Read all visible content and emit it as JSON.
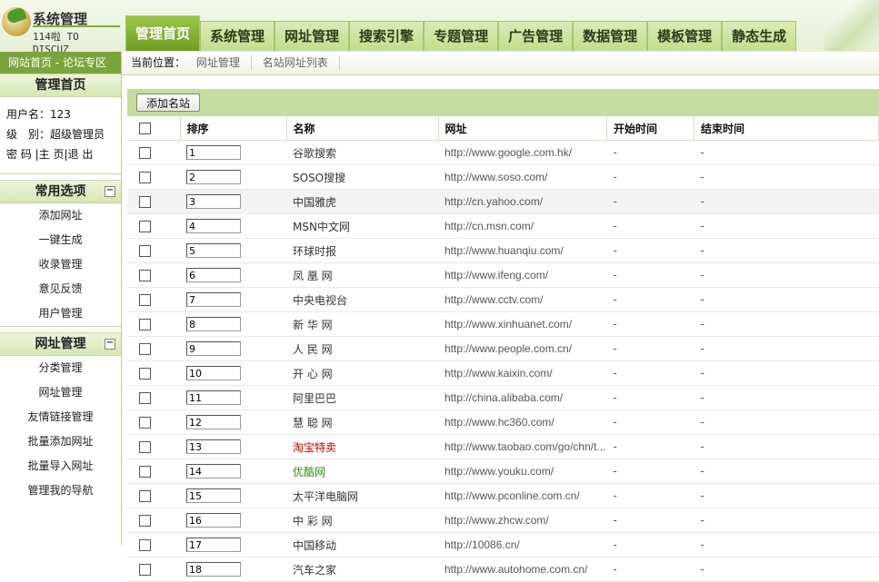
{
  "logo": {
    "title": "系统管理",
    "subtitle": "114啦 TO DISCUZ"
  },
  "nav": {
    "tabs": [
      {
        "label": "管理首页",
        "active": true
      },
      {
        "label": "系统管理"
      },
      {
        "label": "网址管理"
      },
      {
        "label": "搜索引擎"
      },
      {
        "label": "专题管理"
      },
      {
        "label": "广告管理"
      },
      {
        "label": "数据管理"
      },
      {
        "label": "模板管理"
      },
      {
        "label": "静态生成"
      }
    ]
  },
  "sidebar": {
    "top_links": "网站首页 - 论坛专区",
    "home_title": "管理首页",
    "user": {
      "name_line": "用户名：123",
      "level_line": "级　别：超级管理员",
      "links_line": "密 码 |主 页|退 出"
    },
    "sections": [
      {
        "title": "常用选项",
        "toggle": "−",
        "items": [
          "添加网址",
          "一键生成",
          "收录管理",
          "意见反馈",
          "用户管理"
        ]
      },
      {
        "title": "网址管理",
        "toggle": "−",
        "items": [
          "分类管理",
          "网址管理",
          "友情链接管理",
          "批量添加网址",
          "批量导入网址",
          "管理我的导航"
        ]
      }
    ]
  },
  "breadcrumb": {
    "label": "当前位置：",
    "items": [
      "网址管理",
      "名站网址列表"
    ]
  },
  "toolbar": {
    "add_label": "添加名站"
  },
  "table": {
    "headers": [
      "排序",
      "名称",
      "网址",
      "开始时间",
      "结束时间"
    ],
    "rows": [
      {
        "order": "1",
        "name": "谷歌搜索",
        "url": "http://www.google.com.hk/",
        "start": "-",
        "end": "-"
      },
      {
        "order": "2",
        "name": "SOSO搜搜",
        "url": "http://www.soso.com/",
        "start": "-",
        "end": "-"
      },
      {
        "order": "3",
        "name": "中国雅虎",
        "url": "http://cn.yahoo.com/",
        "start": "-",
        "end": "-"
      },
      {
        "order": "4",
        "name": "MSN中文网",
        "url": "http://cn.msn.com/",
        "start": "-",
        "end": "-"
      },
      {
        "order": "5",
        "name": "环球时报",
        "url": "http://www.huanqiu.com/",
        "start": "-",
        "end": "-"
      },
      {
        "order": "6",
        "name": "凤 凰 网",
        "url": "http://www.ifeng.com/",
        "start": "-",
        "end": "-"
      },
      {
        "order": "7",
        "name": "中央电视台",
        "url": "http://www.cctv.com/",
        "start": "-",
        "end": "-"
      },
      {
        "order": "8",
        "name": "新 华 网",
        "url": "http://www.xinhuanet.com/",
        "start": "-",
        "end": "-"
      },
      {
        "order": "9",
        "name": "人 民 网",
        "url": "http://www.people.com.cn/",
        "start": "-",
        "end": "-"
      },
      {
        "order": "10",
        "name": "开 心 网",
        "url": "http://www.kaixin.com/",
        "start": "-",
        "end": "-"
      },
      {
        "order": "11",
        "name": "阿里巴巴",
        "url": "http://china.alibaba.com/",
        "start": "-",
        "end": "-"
      },
      {
        "order": "12",
        "name": "慧 聪 网",
        "url": "http://www.hc360.com/",
        "start": "-",
        "end": "-"
      },
      {
        "order": "13",
        "name": "淘宝特卖",
        "url": "http://www.taobao.com/go/chn/t...",
        "start": "-",
        "end": "-",
        "color": "#cc0000"
      },
      {
        "order": "14",
        "name": "优酷网",
        "url": "http://www.youku.com/",
        "start": "-",
        "end": "-",
        "color": "#2f8a1a"
      },
      {
        "order": "15",
        "name": "太平洋电脑网",
        "url": "http://www.pconline.com.cn/",
        "start": "-",
        "end": "-"
      },
      {
        "order": "16",
        "name": "中 彩 网",
        "url": "http://www.zhcw.com/",
        "start": "-",
        "end": "-"
      },
      {
        "order": "17",
        "name": "中国移动",
        "url": "http://10086.cn/",
        "start": "-",
        "end": "-"
      },
      {
        "order": "18",
        "name": "汽车之家",
        "url": "http://www.autohome.com.cn/",
        "start": "-",
        "end": "-"
      }
    ]
  }
}
